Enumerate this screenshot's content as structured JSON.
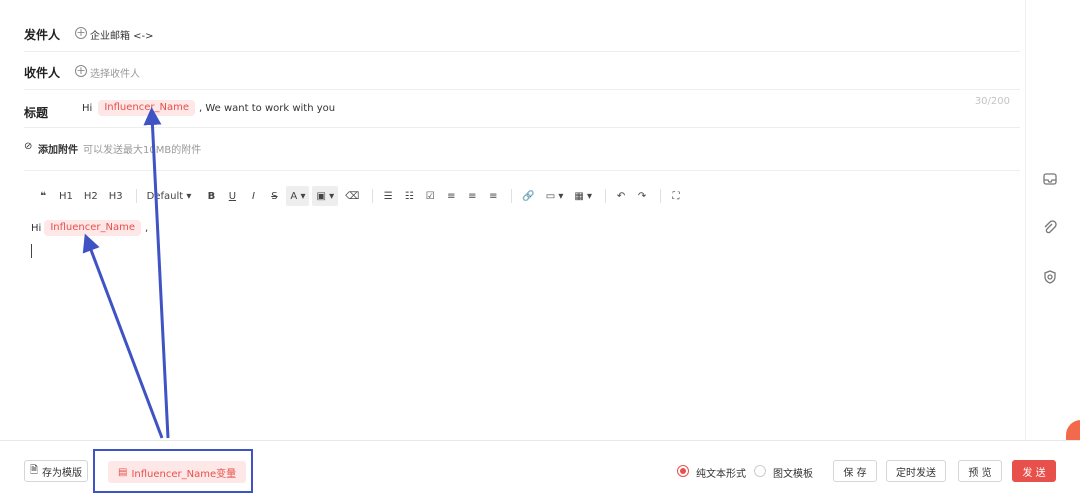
{
  "header": {
    "sender_label": "发件人",
    "sender_value": "企业邮箱 <->",
    "recipient_label": "收件人",
    "recipient_placeholder": "选择收件人",
    "subject_label": "标题",
    "subject_prefix": "Hi",
    "subject_variable": "Influencer_Name",
    "subject_suffix": ", We want to work with you",
    "subject_counter": "30/200",
    "attach_label": "添加附件",
    "attach_hint": "可以发送最大10MB的附件"
  },
  "toolbar": {
    "quote": "❝",
    "h1": "H1",
    "h2": "H2",
    "h3": "H3",
    "font": "Default ▾",
    "bold": "B",
    "underline": "U",
    "italic": "I",
    "strike": "S",
    "text_color": "A ▾",
    "bg_color": "▣ ▾",
    "clear": "⌫",
    "ul": "☰",
    "ol": "☷",
    "todo": "☑",
    "align_left": "≡",
    "align_center": "≡",
    "align_right": "≡",
    "link": "🔗",
    "image": "▭ ▾",
    "table": "▦ ▾",
    "undo": "↶",
    "redo": "↷",
    "fullscreen": "⛶"
  },
  "editor": {
    "greeting": "Hi",
    "variable": "Influencer_Name",
    "comma": ","
  },
  "footer": {
    "save_template": "存为模版",
    "variable_button": "Influencer_Name变量",
    "mode_plain": "纯文本形式",
    "mode_rich": "图文模板",
    "save": "保 存",
    "schedule": "定时发送",
    "preview": "预 览",
    "send": "发 送"
  },
  "colors": {
    "accent": "#e8504b",
    "chip_bg": "#fde7e7",
    "annotation": "#3f53c4"
  }
}
